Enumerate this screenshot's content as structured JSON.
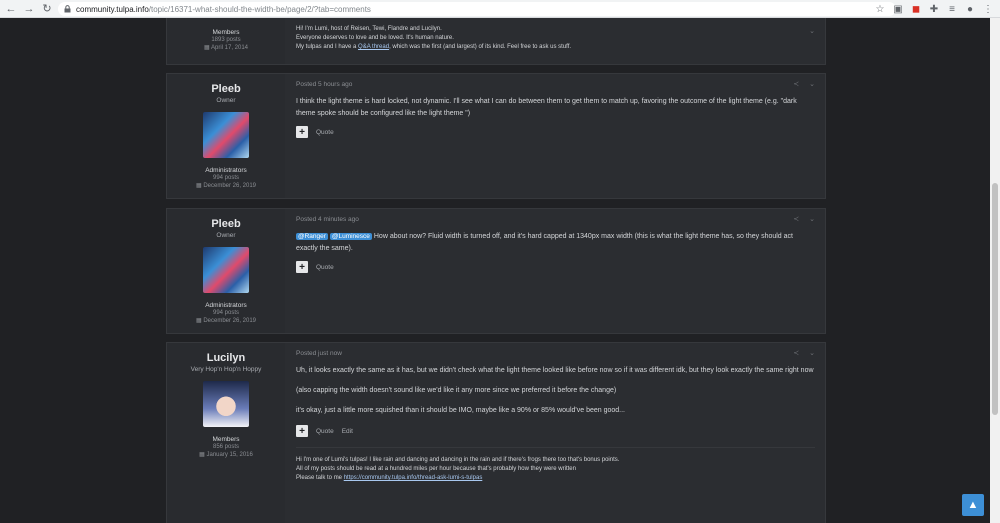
{
  "browser": {
    "url_domain": "community.tulpa.info",
    "url_path": "/topic/16371-what-should-the-width-be/page/2/?tab=comments"
  },
  "top_fragment": {
    "group": "Members",
    "posts": "1893 posts",
    "joined": "April 17, 2014",
    "signature_line1": "Hi! I'm Lumi, host of Reisen, Tewi, Flandre and Lucilyn.",
    "signature_line2": "Everyone deserves to love and be loved. It's human nature.",
    "signature_line3_pre": "My tulpas and I have a ",
    "signature_line3_link": "Q&A thread",
    "signature_line3_post": ", which was the first (and largest) of its kind. Feel free to ask us stuff."
  },
  "posts": [
    {
      "author": "Pleeb",
      "title": "Owner",
      "group": "Administrators",
      "posts": "994 posts",
      "joined": "December 26, 2019",
      "time": "Posted 5 hours ago",
      "text": "I think the light theme is hard locked, not dynamic. I'll see what I can do between them to get them to match up, favoring the outcome of the light theme (e.g. \"dark theme spoke should be configured like the light theme \")",
      "quote": "Quote"
    },
    {
      "author": "Pleeb",
      "title": "Owner",
      "group": "Administrators",
      "posts": "994 posts",
      "joined": "December 26, 2019",
      "time": "Posted 4 minutes ago",
      "mention1": "@Ranger",
      "mention2": "@Luminesce",
      "text": " How about now? Fluid width is turned off, and it's hard capped at 1340px max width (this is what the light theme has, so they should act exactly the same).",
      "quote": "Quote"
    },
    {
      "author": "Lucilyn",
      "title": "Very Hop'n Hop'n Hoppy",
      "group": "Members",
      "posts": "856 posts",
      "joined": "January 15, 2016",
      "time": "Posted just now",
      "para1": "Uh, it looks exactly the same as it has, but we didn't check what the light theme looked like before now so if it was different idk, but they look exactly the same right now",
      "para2": "(also capping the width doesn't sound like we'd like it any more since we preferred it before the change)",
      "para3": "it's okay, just a little more squished than it should be IMO, maybe like a 90% or 85% would've been good...",
      "quote": "Quote",
      "edit": "Edit",
      "sig1": "Hi I'm one of Lumi's tulpas! I like rain and dancing and dancing in the rain and if there's frogs there too that's bonus points.",
      "sig2": "All of my posts should be read at a hundred miles per hour because that's probably how they were written",
      "sig3_pre": "Please talk to me ",
      "sig3_link": "https://community.tulpa.info/thread-ask-lumi-s-tulpas"
    }
  ]
}
